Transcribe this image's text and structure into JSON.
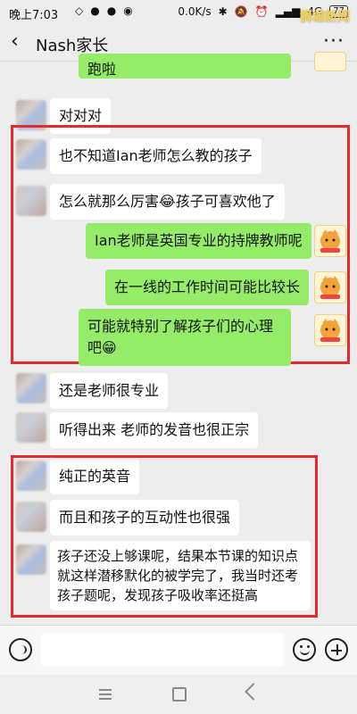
{
  "status_bar": {
    "time": "晚上7:03",
    "network_speed": "0.0K/s",
    "signal": "4G",
    "battery": "77",
    "watermark": "狮城新闻"
  },
  "header": {
    "title": "Nash家长",
    "more": "···"
  },
  "messages": [
    {
      "side": "right",
      "text": "跑啦"
    },
    {
      "side": "left",
      "text": "对对对"
    },
    {
      "side": "left",
      "text": "也不知道Ian老师怎么教的孩子"
    },
    {
      "side": "left",
      "text": "怎么就那么厉害😂孩子可喜欢他了"
    },
    {
      "side": "right",
      "text": "Ian老师是英国专业的持牌教师呢"
    },
    {
      "side": "right",
      "text": "在一线的工作时间可能比较长"
    },
    {
      "side": "right",
      "text": "可能就特别了解孩子们的心理吧😁"
    },
    {
      "side": "left",
      "text": "还是老师很专业"
    },
    {
      "side": "left",
      "text": "听得出来 老师的发音也很正宗"
    },
    {
      "side": "left",
      "text": "纯正的英音"
    },
    {
      "side": "left",
      "text": "而且和孩子的互动性也很强"
    },
    {
      "side": "left",
      "text": "孩子还没上够课呢，结果本节课的知识点就这样潜移默化的被学完了，我当时还考孩子题呢，发现孩子吸收率还挺高"
    }
  ]
}
